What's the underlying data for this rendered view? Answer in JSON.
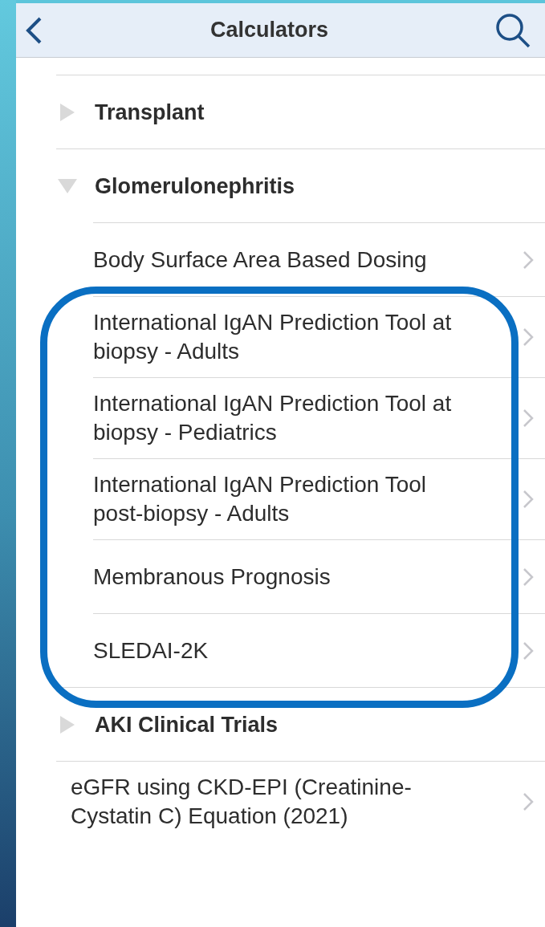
{
  "nav_bar": {
    "title": "Calculators"
  },
  "list": [
    {
      "kind": "group",
      "label": "Transplant",
      "expanded": false
    },
    {
      "kind": "group",
      "label": "Glomerulonephritis",
      "expanded": true,
      "children": [
        {
          "label": "Body Surface Area Based Dosing",
          "highlighted": false
        },
        {
          "label": "International IgAN Prediction Tool at biopsy - Adults",
          "highlighted": true
        },
        {
          "label": "International IgAN Prediction Tool at biopsy - Pediatrics",
          "highlighted": true
        },
        {
          "label": "International IgAN Prediction Tool post-biopsy - Adults",
          "highlighted": true
        },
        {
          "label": "Membranous Prognosis",
          "highlighted": true
        },
        {
          "label": "SLEDAI-2K",
          "highlighted": true
        }
      ]
    },
    {
      "kind": "group",
      "label": "AKI Clinical Trials",
      "expanded": false
    },
    {
      "kind": "item",
      "label": "eGFR using CKD-EPI (Creatinine-Cystatin C) Equation (2021)"
    }
  ]
}
